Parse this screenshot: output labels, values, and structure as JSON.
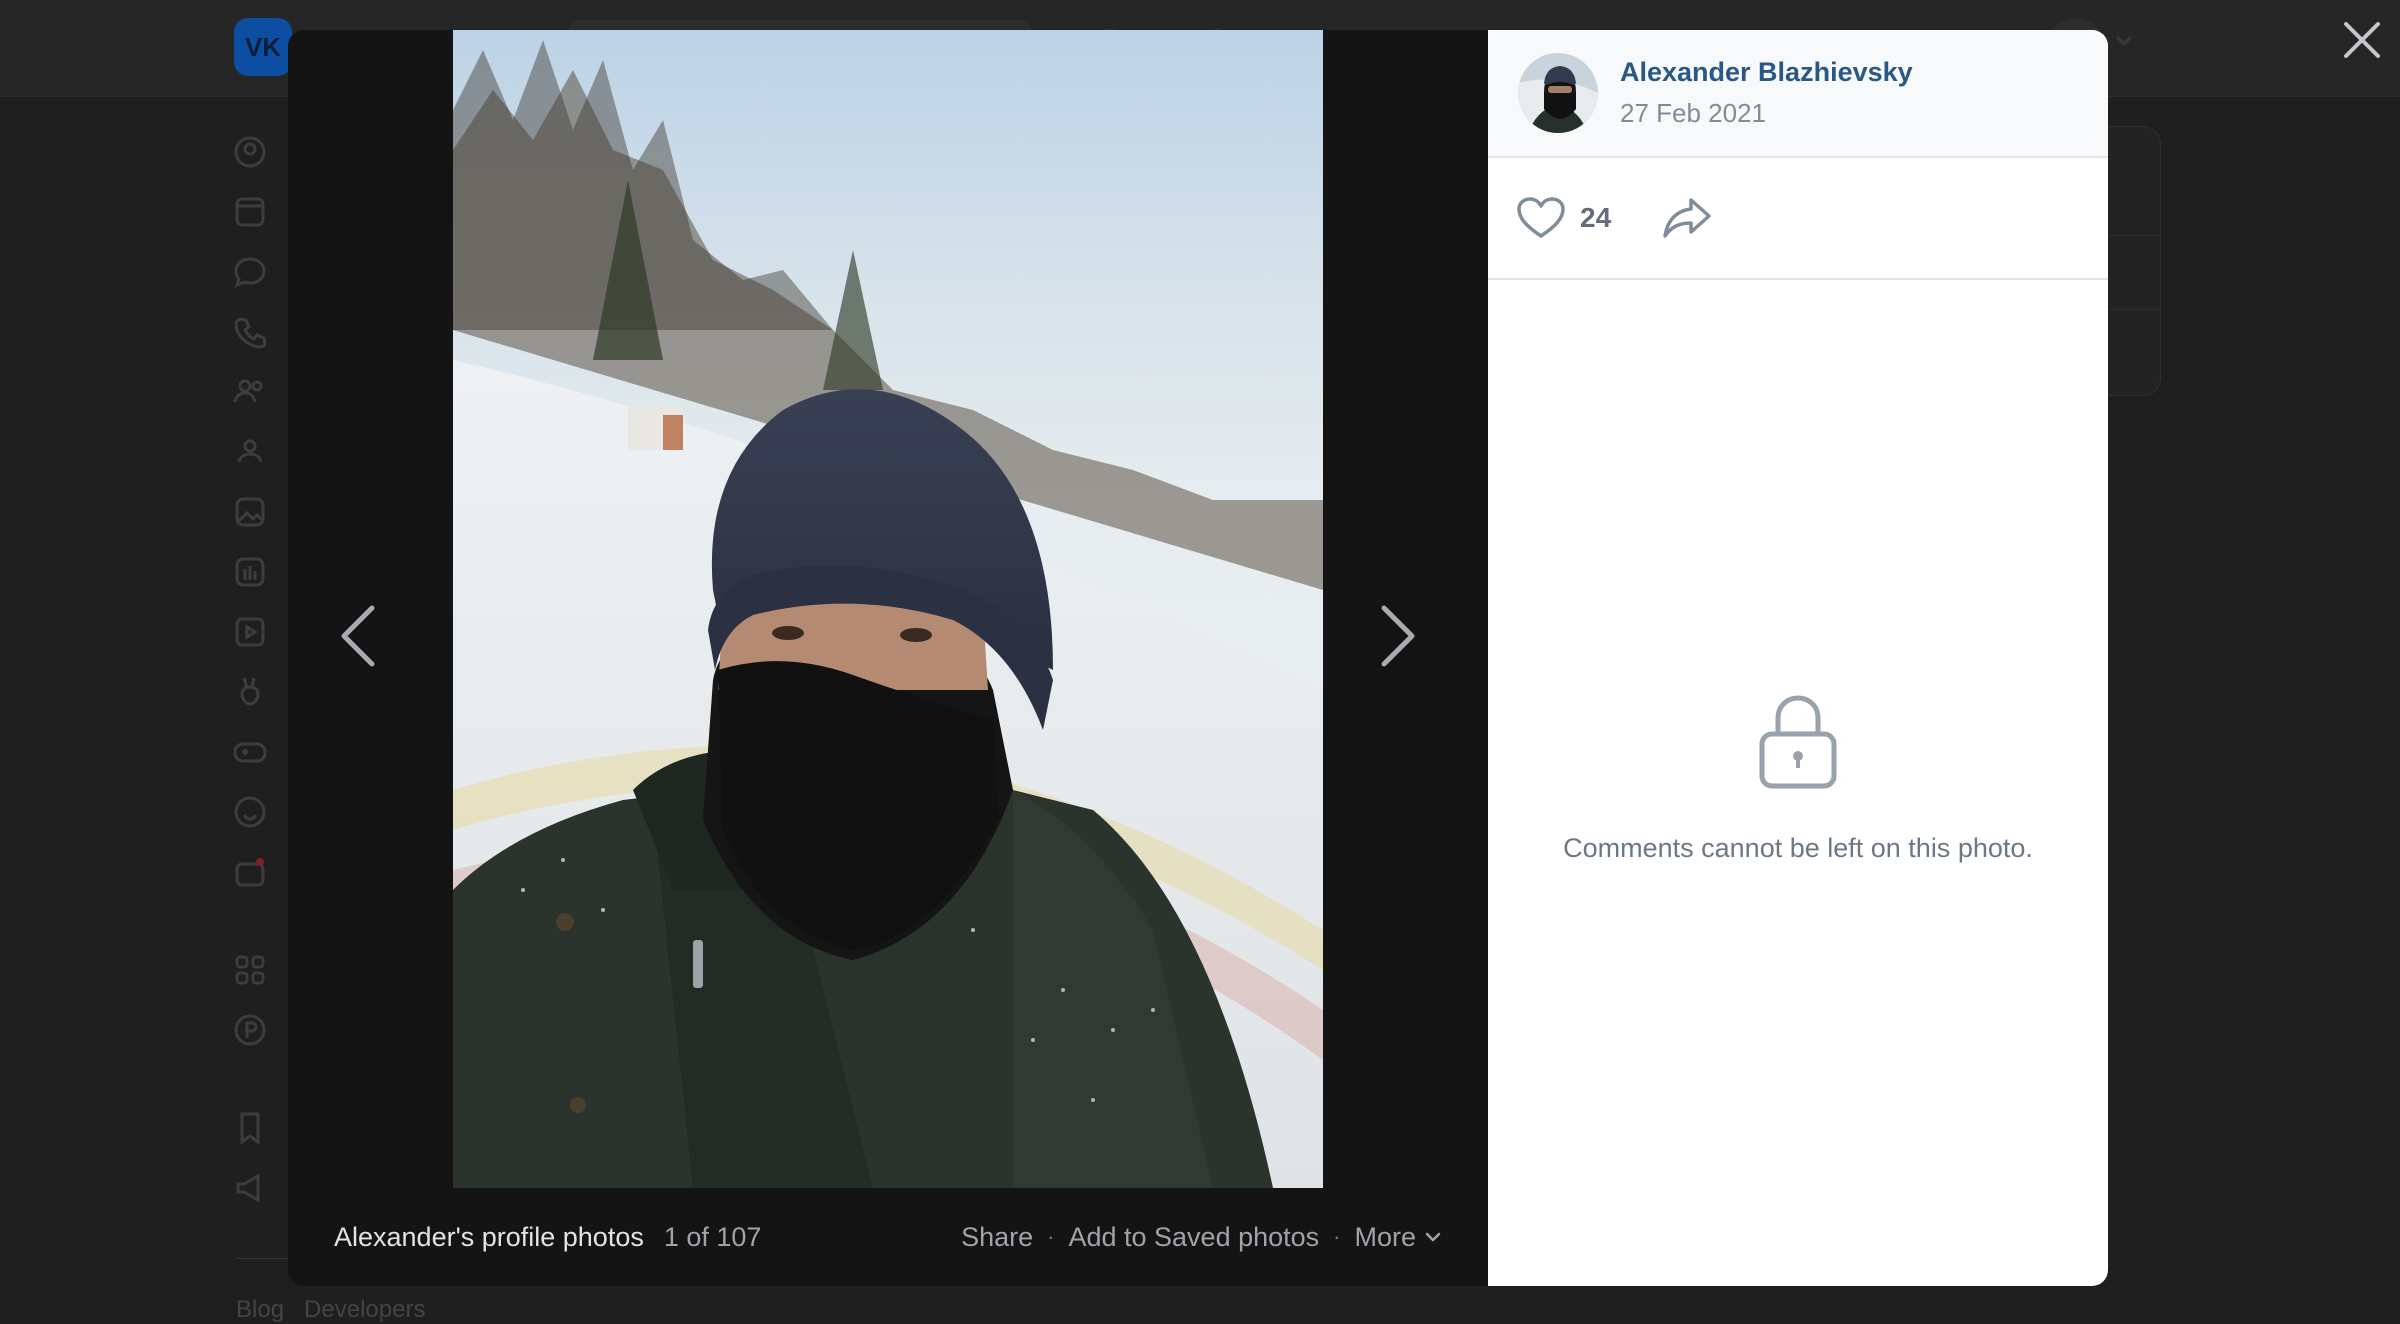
{
  "background": {
    "logo_text": "VK",
    "footer_links": [
      "Blog",
      "Developers"
    ]
  },
  "viewer": {
    "album_title": "Alexander's profile photos",
    "counter": "1 of 107",
    "actions": {
      "share": "Share",
      "save": "Add to Saved photos",
      "more": "More"
    }
  },
  "side": {
    "author_name": "Alexander Blazhievsky",
    "date": "27 Feb 2021",
    "likes": "24",
    "comments_locked": "Comments cannot be left on this photo."
  },
  "icons": {
    "close": "close-icon",
    "prev": "chevron-left-icon",
    "next": "chevron-right-icon",
    "like": "heart-icon",
    "share": "share-arrow-icon",
    "lock": "lock-icon",
    "more": "chevron-down-icon"
  },
  "colors": {
    "link": "#2a5885",
    "secondary_text": "#818c99",
    "viewer_bg": "#141414"
  }
}
